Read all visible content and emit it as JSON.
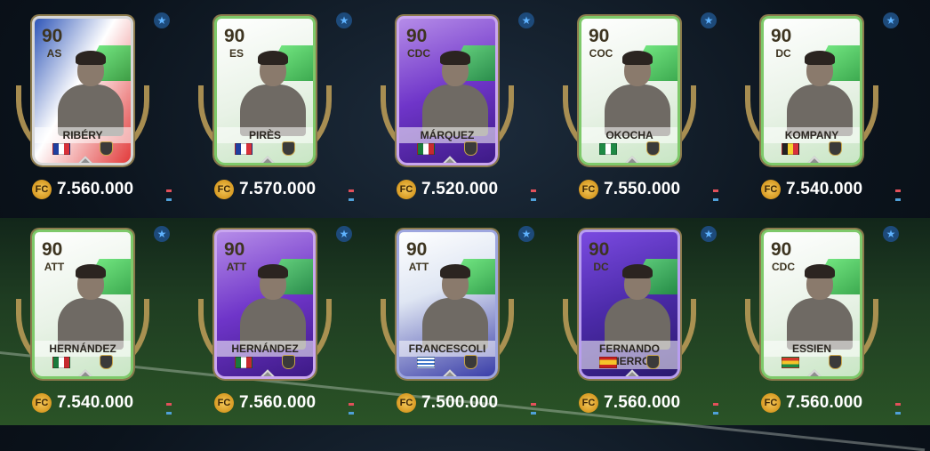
{
  "icons": {
    "star": "star-icon",
    "coin": "coin-icon"
  },
  "cards": [
    {
      "rating": "90",
      "position": "AS",
      "name": "RIBÉRY",
      "theme": "flag",
      "flag": "france",
      "coin_label": "FC",
      "price": "7.560.000"
    },
    {
      "rating": "90",
      "position": "ES",
      "name": "PIRÈS",
      "theme": "green",
      "flag": "france",
      "coin_label": "FC",
      "price": "7.570.000"
    },
    {
      "rating": "90",
      "position": "CDC",
      "name": "MÁRQUEZ",
      "theme": "purple",
      "flag": "mexico",
      "coin_label": "FC",
      "price": "7.520.000"
    },
    {
      "rating": "90",
      "position": "COC",
      "name": "OKOCHA",
      "theme": "green",
      "flag": "nigeria",
      "coin_label": "FC",
      "price": "7.550.000"
    },
    {
      "rating": "90",
      "position": "DC",
      "name": "KOMPANY",
      "theme": "green",
      "flag": "belgium",
      "coin_label": "FC",
      "price": "7.540.000"
    },
    {
      "rating": "90",
      "position": "ATT",
      "name": "HERNÁNDEZ",
      "theme": "green",
      "flag": "mexico",
      "coin_label": "FC",
      "price": "7.540.000"
    },
    {
      "rating": "90",
      "position": "ATT",
      "name": "HERNÁNDEZ",
      "theme": "purple",
      "flag": "mexico",
      "coin_label": "FC",
      "price": "7.560.000"
    },
    {
      "rating": "90",
      "position": "ATT",
      "name": "FRANCESCOLI",
      "theme": "blue",
      "flag": "uruguay",
      "coin_label": "FC",
      "price": "7.500.000"
    },
    {
      "rating": "90",
      "position": "DC",
      "name": "FERNANDO HIERRO",
      "theme": "violet",
      "flag": "spain",
      "coin_label": "FC",
      "price": "7.560.000"
    },
    {
      "rating": "90",
      "position": "CDC",
      "name": "ESSIEN",
      "theme": "green",
      "flag": "ghana",
      "coin_label": "FC",
      "price": "7.560.000"
    }
  ],
  "colors": {
    "price_text": "#ffffff",
    "star_bg": "#1d4a7a",
    "accent_red": "#e2505a",
    "accent_blue": "#4fa0d8"
  }
}
